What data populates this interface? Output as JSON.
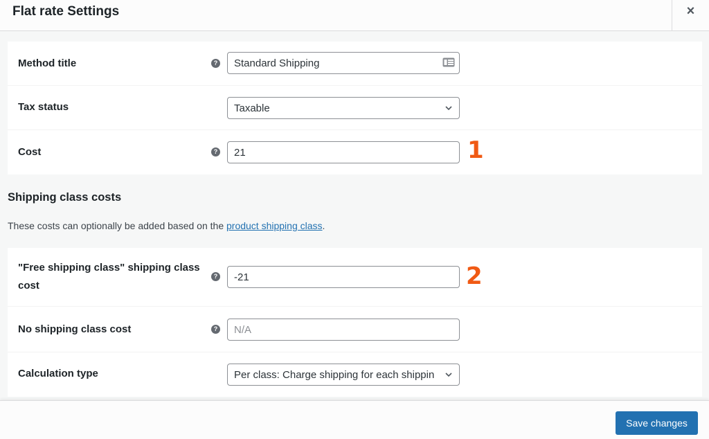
{
  "modal": {
    "title": "Flat rate Settings",
    "close_icon": "close-icon"
  },
  "general": {
    "rows": [
      {
        "label": "Method title",
        "has_help": true,
        "help_icon": "question-circle-icon",
        "type": "text",
        "value": "Standard Shipping",
        "trailing_icon": "id-card-icon"
      },
      {
        "label": "Tax status",
        "has_help": false,
        "type": "select",
        "value": "Taxable"
      },
      {
        "label": "Cost",
        "has_help": true,
        "help_icon": "question-circle-icon",
        "type": "text",
        "value": "21",
        "annotation": "1"
      }
    ]
  },
  "shipping_class": {
    "title": "Shipping class costs",
    "desc_prefix": "These costs can optionally be added based on the ",
    "link_text": "product shipping class",
    "desc_suffix": ".",
    "rows": [
      {
        "label_line1": "\"Free shipping class\" shipping class",
        "label_line2": "cost",
        "has_help": true,
        "type": "text",
        "value": "-21",
        "annotation": "2"
      },
      {
        "label": "No shipping class cost",
        "has_help": true,
        "type": "text",
        "value": "",
        "placeholder": "N/A"
      },
      {
        "label": "Calculation type",
        "has_help": false,
        "type": "select",
        "value": "Per class: Charge shipping for each shippin"
      }
    ]
  },
  "footer": {
    "save_label": "Save changes"
  },
  "colors": {
    "accent": "#2271b1",
    "annotation": "#f05a14"
  }
}
